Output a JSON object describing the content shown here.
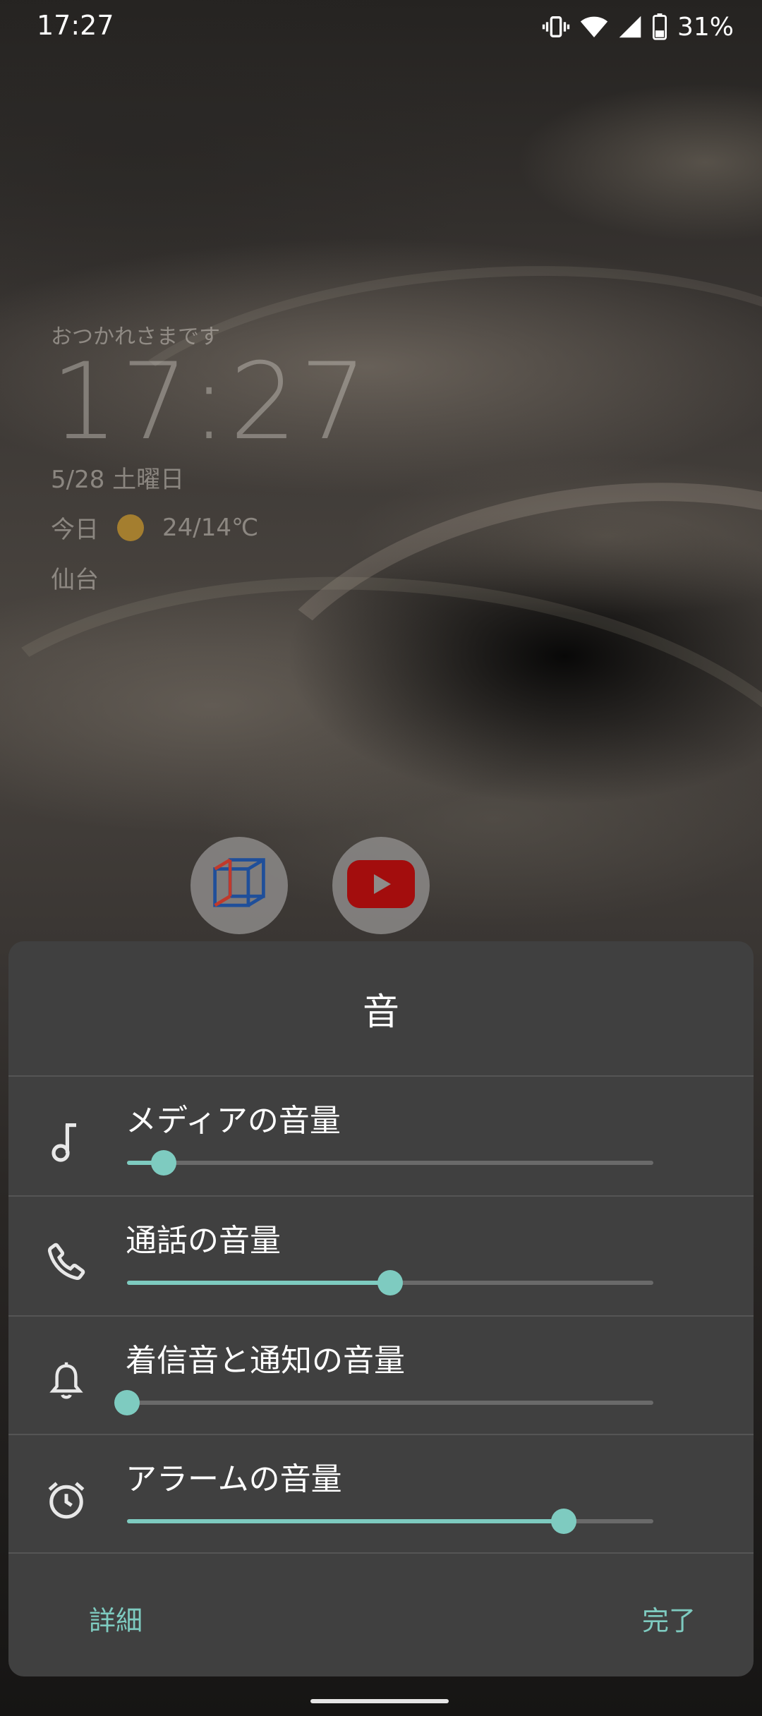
{
  "status_bar": {
    "time": "17:27",
    "icons": [
      "vibrate-icon",
      "wifi-icon",
      "signal-icon",
      "battery-icon"
    ],
    "battery_percent": "31%"
  },
  "lock_screen": {
    "greeting": "おつかれさまです",
    "clock": "17:27",
    "date": "5/28 土曜日",
    "weather": {
      "day": "今日",
      "icon": "sun-icon",
      "temperature": "24/14℃"
    },
    "city": "仙台"
  },
  "shortcuts": [
    {
      "name": "cube-app-icon"
    },
    {
      "name": "youtube-icon"
    }
  ],
  "volume_panel": {
    "title": "音",
    "rows": [
      {
        "label": "メディアの音量",
        "icon": "music-note-icon",
        "level": 0.07
      },
      {
        "label": "通話の音量",
        "icon": "phone-icon",
        "level": 0.5
      },
      {
        "label": "着信音と通知の音量",
        "icon": "bell-icon",
        "level": 0.0
      },
      {
        "label": "アラームの音量",
        "icon": "alarm-clock-icon",
        "level": 0.83
      }
    ],
    "detail_button": "詳細",
    "done_button": "完了"
  },
  "colors": {
    "accent": "#7ecbc0",
    "panel": "#404040",
    "track": "#6a6a6a"
  }
}
